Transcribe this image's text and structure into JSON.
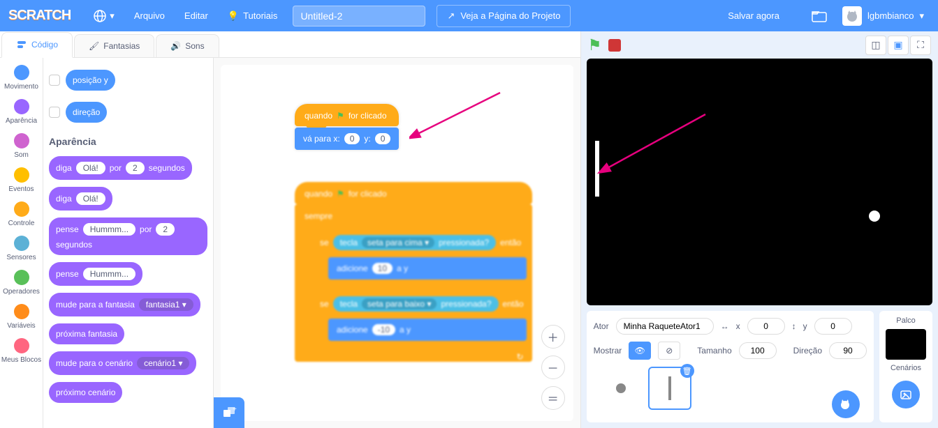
{
  "menu": {
    "logo": "SCRATCH",
    "file": "Arquivo",
    "edit": "Editar",
    "tutorials": "Tutoriais",
    "project_title": "Untitled-2",
    "project_page": "Veja a Página do Projeto",
    "save_now": "Salvar agora",
    "username": "lgbmbianco"
  },
  "tabs": {
    "code": "Código",
    "costumes": "Fantasias",
    "sounds": "Sons"
  },
  "categories": {
    "motion": "Movimento",
    "looks": "Aparência",
    "sound": "Som",
    "events": "Eventos",
    "control": "Controle",
    "sensing": "Sensores",
    "operators": "Operadores",
    "variables": "Variáveis",
    "myblocks": "Meus Blocos"
  },
  "category_colors": {
    "motion": "#4c97ff",
    "looks": "#9966ff",
    "sound": "#cf63cf",
    "events": "#ffbf00",
    "control": "#ffab19",
    "sensing": "#5cb1d6",
    "operators": "#59c059",
    "variables": "#ff8c1a",
    "myblocks": "#ff6680"
  },
  "palette": {
    "reporters": {
      "ypos": "posição y",
      "direction": "direção"
    },
    "heading_looks": "Aparência",
    "say_for": {
      "pre": "diga",
      "arg1": "Olá!",
      "mid": "por",
      "arg2": "2",
      "post": "segundos"
    },
    "say": {
      "pre": "diga",
      "arg1": "Olá!"
    },
    "think_for": {
      "pre": "pense",
      "arg1": "Hummm...",
      "mid": "por",
      "arg2": "2",
      "post": "segundos"
    },
    "think": {
      "pre": "pense",
      "arg1": "Hummm..."
    },
    "switch_costume": {
      "pre": "mude para a fantasia",
      "arg1": "fantasia1"
    },
    "next_costume": "próxima fantasia",
    "switch_backdrop": {
      "pre": "mude para o cenário",
      "arg1": "cenário1"
    },
    "next_backdrop": "próximo cenário"
  },
  "scripts": {
    "s1": {
      "hat": {
        "pre": "quando",
        "post": "for clicado"
      },
      "goto": {
        "pre": "vá para x:",
        "x": "0",
        "mid": "y:",
        "y": "0"
      }
    },
    "s2": {
      "hat": {
        "pre": "quando",
        "post": "for clicado"
      },
      "forever": "sempre",
      "if1": {
        "se": "se",
        "entao": "então",
        "tecla": "tecla",
        "key": "seta para cima",
        "pressed": "pressionada?"
      },
      "changey1": {
        "pre": "adicione",
        "val": "10",
        "post": "a y"
      },
      "if2": {
        "se": "se",
        "entao": "então",
        "tecla": "tecla",
        "key": "seta para baixo",
        "pressed": "pressionada?"
      },
      "changey2": {
        "pre": "adicione",
        "val": "-10",
        "post": "a y"
      }
    }
  },
  "sprite_info": {
    "actor_label": "Ator",
    "name": "Minha RaqueteAtor1",
    "x_label": "x",
    "x": "0",
    "y_label": "y",
    "y": "0",
    "show_label": "Mostrar",
    "size_label": "Tamanho",
    "size": "100",
    "dir_label": "Direção",
    "dir": "90"
  },
  "stage_panel": {
    "label": "Palco",
    "backdrops": "Cenários"
  },
  "chart_data": null
}
